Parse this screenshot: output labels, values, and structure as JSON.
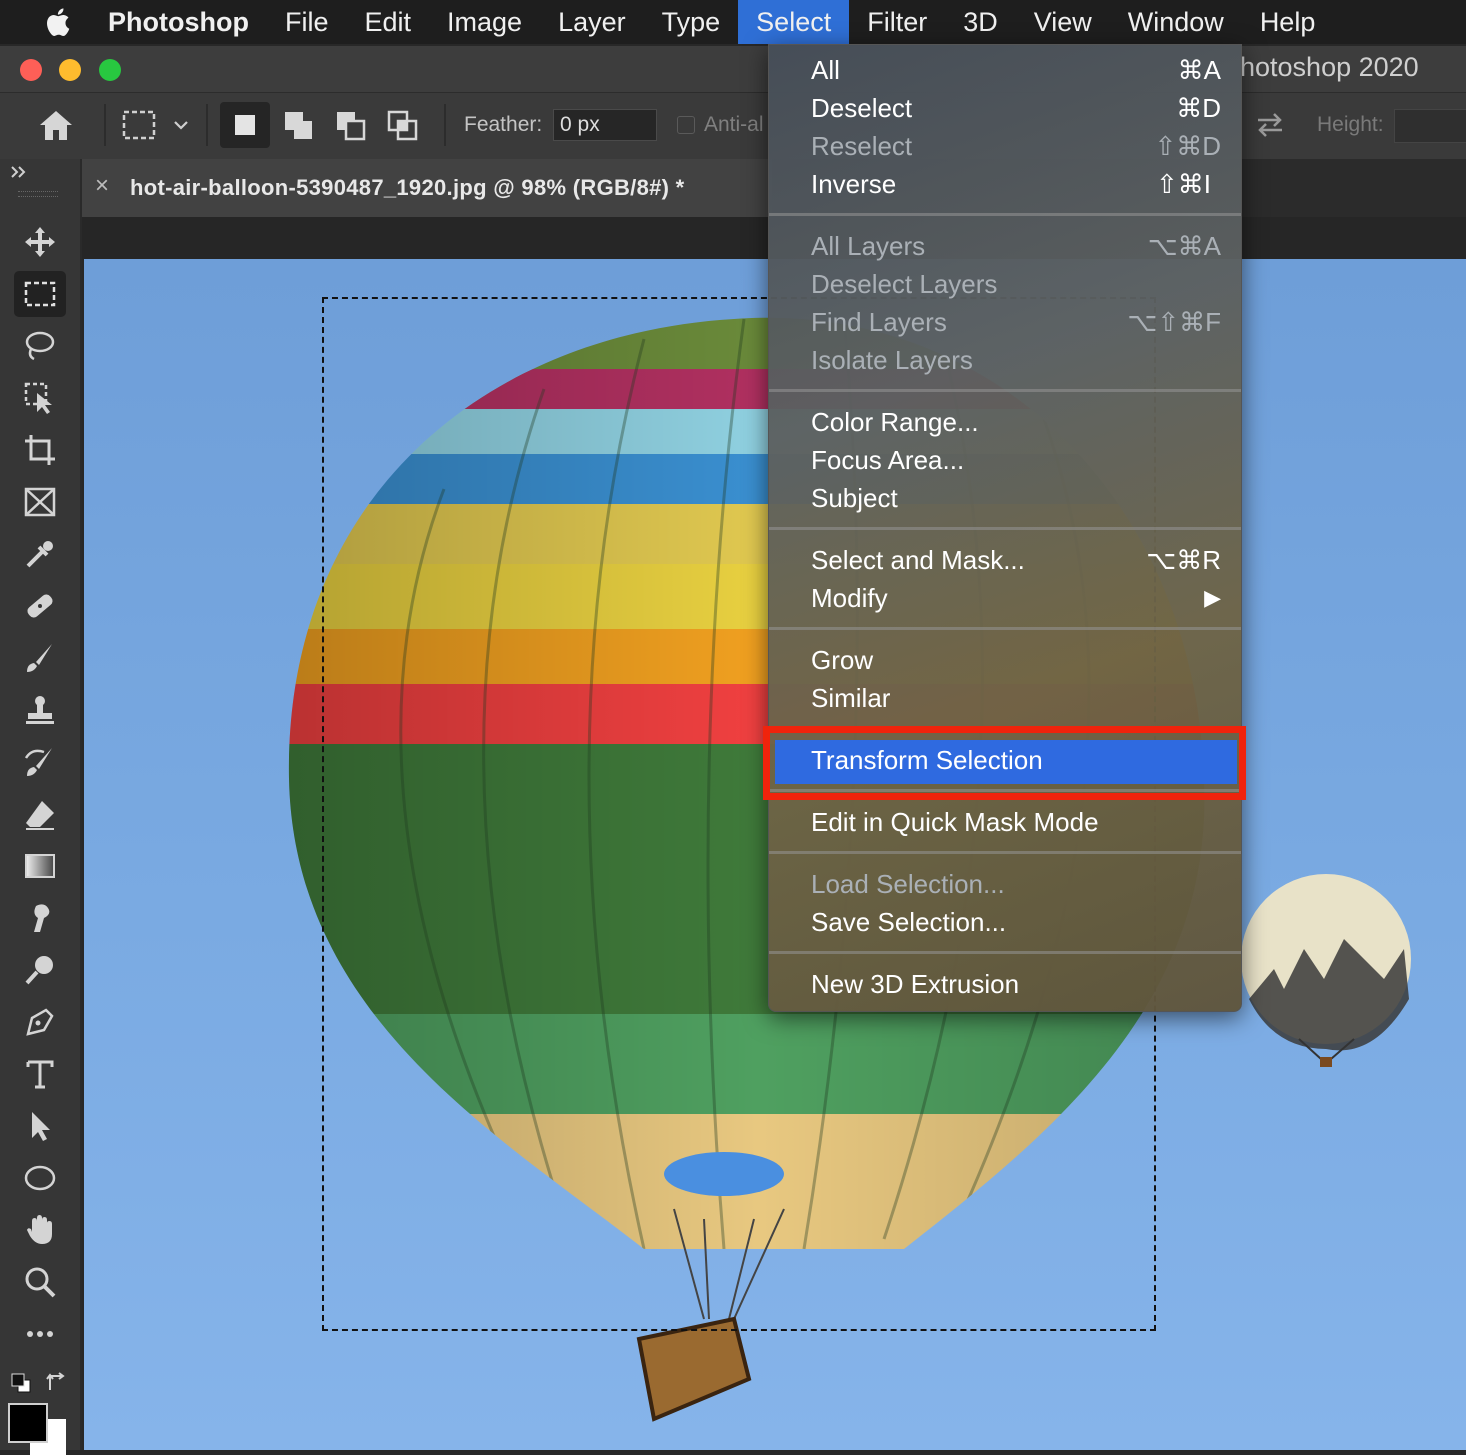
{
  "menubar": {
    "app": "Photoshop",
    "items": [
      "File",
      "Edit",
      "Image",
      "Layer",
      "Type",
      "Select",
      "Filter",
      "3D",
      "View",
      "Window",
      "Help"
    ],
    "active": "Select"
  },
  "window": {
    "title_partial": "hotoshop 2020"
  },
  "options": {
    "feather_label": "Feather:",
    "feather_value": "0 px",
    "antialias_label": "Anti-al",
    "height_label": "Height:"
  },
  "document": {
    "tab_title": "hot-air-balloon-5390487_1920.jpg @ 98% (RGB/8#) *",
    "close_glyph": "×"
  },
  "select_menu": {
    "items": [
      {
        "label": "All",
        "shortcut": "⌘A",
        "enabled": true
      },
      {
        "label": "Deselect",
        "shortcut": "⌘D",
        "enabled": true
      },
      {
        "label": "Reselect",
        "shortcut": "⇧⌘D",
        "enabled": false
      },
      {
        "label": "Inverse",
        "shortcut": "⇧⌘I",
        "enabled": true
      },
      {
        "label": "All Layers",
        "shortcut": "⌥⌘A",
        "enabled": false
      },
      {
        "label": "Deselect Layers",
        "shortcut": "",
        "enabled": false
      },
      {
        "label": "Find Layers",
        "shortcut": "⌥⇧⌘F",
        "enabled": false
      },
      {
        "label": "Isolate Layers",
        "shortcut": "",
        "enabled": false
      },
      {
        "label": "Color Range...",
        "shortcut": "",
        "enabled": true
      },
      {
        "label": "Focus Area...",
        "shortcut": "",
        "enabled": true
      },
      {
        "label": "Subject",
        "shortcut": "",
        "enabled": true
      },
      {
        "label": "Select and Mask...",
        "shortcut": "⌥⌘R",
        "enabled": true
      },
      {
        "label": "Modify",
        "shortcut": "▶",
        "enabled": true
      },
      {
        "label": "Grow",
        "shortcut": "",
        "enabled": true
      },
      {
        "label": "Similar",
        "shortcut": "",
        "enabled": true
      },
      {
        "label": "Transform Selection",
        "shortcut": "",
        "enabled": true,
        "highlighted": true
      },
      {
        "label": "Edit in Quick Mask Mode",
        "shortcut": "",
        "enabled": true
      },
      {
        "label": "Load Selection...",
        "shortcut": "",
        "enabled": false
      },
      {
        "label": "Save Selection...",
        "shortcut": "",
        "enabled": true
      },
      {
        "label": "New 3D Extrusion",
        "shortcut": "",
        "enabled": true
      }
    ]
  },
  "colors": {
    "menu_highlight": "#2f6ae0",
    "callout_red": "#f0230c",
    "sky": "#7aaae2"
  },
  "tools": [
    "move-tool",
    "rectangular-marquee-tool",
    "lasso-tool",
    "object-selection-tool",
    "crop-tool",
    "frame-tool",
    "eyedropper-tool",
    "healing-brush-tool",
    "brush-tool",
    "clone-stamp-tool",
    "history-brush-tool",
    "eraser-tool",
    "gradient-tool",
    "smudge-tool",
    "dodge-tool",
    "pen-tool",
    "type-tool",
    "path-selection-tool",
    "ellipse-tool",
    "hand-tool",
    "zoom-tool",
    "more-tools"
  ]
}
